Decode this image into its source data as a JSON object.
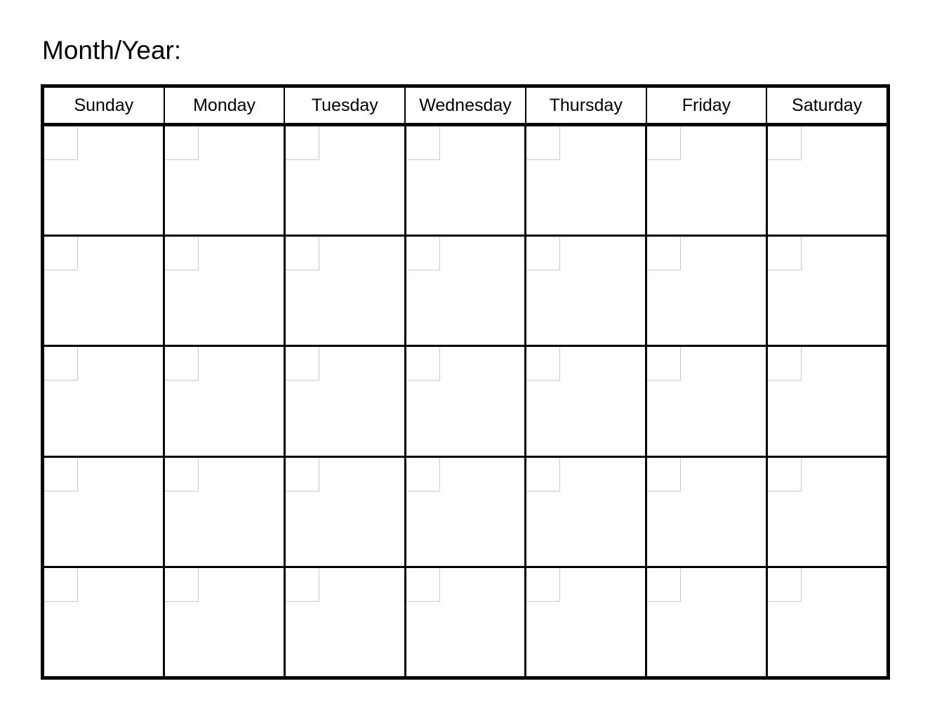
{
  "page": {
    "title": "Month/Year:",
    "background_color": "#ffffff",
    "border_color": "#000000",
    "date_box_border_color": "#c9c9c9"
  },
  "calendar": {
    "weekday_headers": [
      "Sunday",
      "Monday",
      "Tuesday",
      "Wednesday",
      "Thursday",
      "Friday",
      "Saturday"
    ],
    "week_count": 5,
    "day_columns": 7,
    "weeks": [
      {
        "days": [
          "",
          "",
          "",
          "",
          "",
          "",
          ""
        ]
      },
      {
        "days": [
          "",
          "",
          "",
          "",
          "",
          "",
          ""
        ]
      },
      {
        "days": [
          "",
          "",
          "",
          "",
          "",
          "",
          ""
        ]
      },
      {
        "days": [
          "",
          "",
          "",
          "",
          "",
          "",
          ""
        ]
      },
      {
        "days": [
          "",
          "",
          "",
          "",
          "",
          "",
          ""
        ]
      }
    ]
  }
}
